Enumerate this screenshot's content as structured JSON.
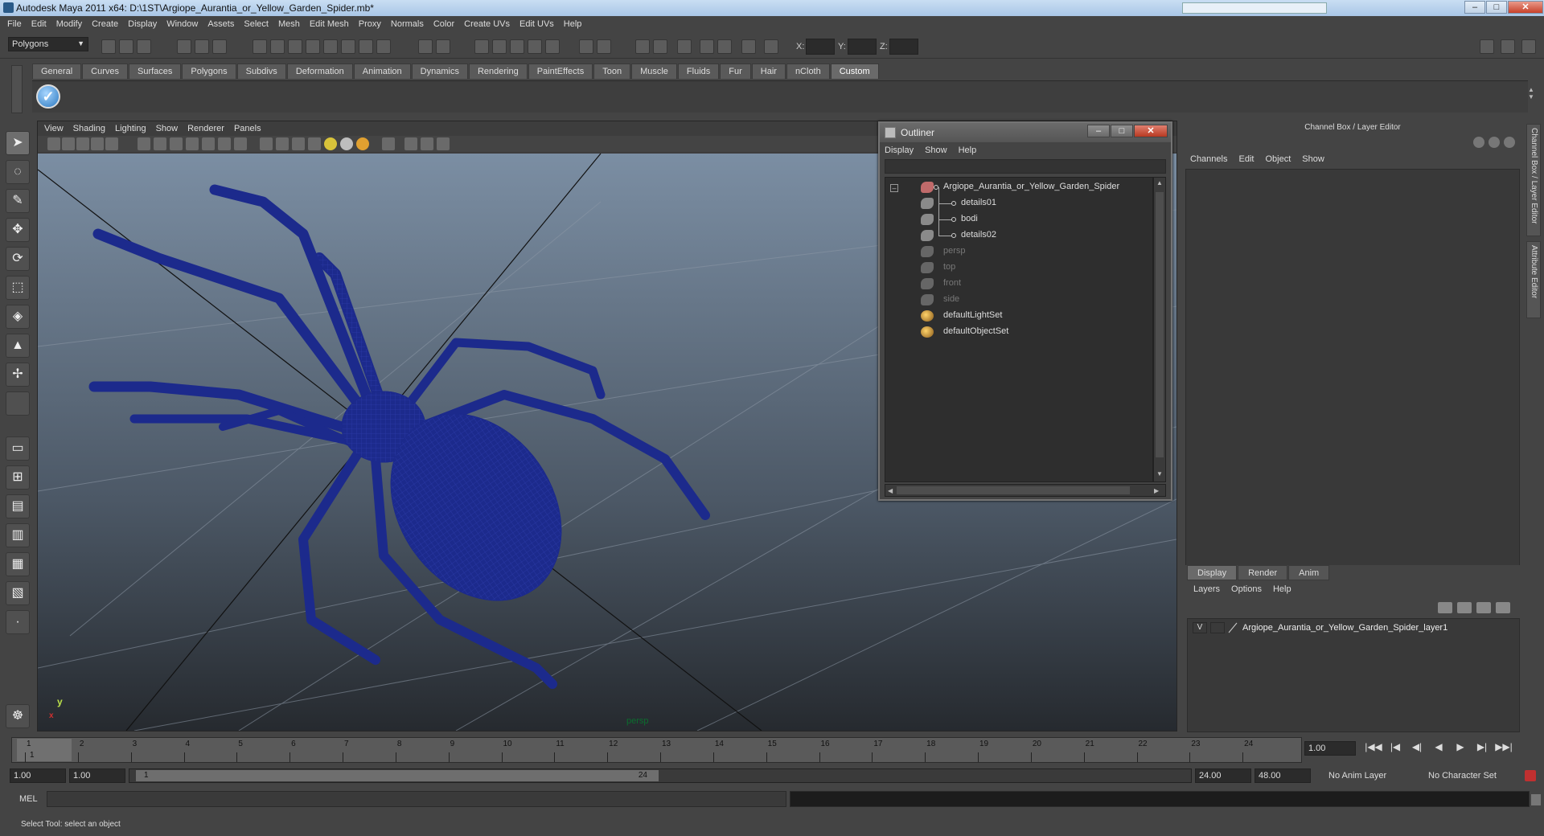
{
  "window": {
    "title": "Autodesk Maya 2011 x64: D:\\1ST\\Argiope_Aurantia_or_Yellow_Garden_Spider.mb*",
    "minimize": "–",
    "maximize": "□",
    "close": "✕"
  },
  "menubar": [
    "File",
    "Edit",
    "Modify",
    "Create",
    "Display",
    "Window",
    "Assets",
    "Select",
    "Mesh",
    "Edit Mesh",
    "Proxy",
    "Normals",
    "Color",
    "Create UVs",
    "Edit UVs",
    "Help"
  ],
  "statusline": {
    "mode": "Polygons",
    "x_label": "X:",
    "y_label": "Y:",
    "z_label": "Z:"
  },
  "shelf": {
    "tabs": [
      "General",
      "Curves",
      "Surfaces",
      "Polygons",
      "Subdivs",
      "Deformation",
      "Animation",
      "Dynamics",
      "Rendering",
      "PaintEffects",
      "Toon",
      "Muscle",
      "Fluids",
      "Fur",
      "Hair",
      "nCloth",
      "Custom"
    ],
    "active_tab": "Custom",
    "check_glyph": "✓"
  },
  "viewport": {
    "menu": [
      "View",
      "Shading",
      "Lighting",
      "Show",
      "Renderer",
      "Panels"
    ],
    "camera_label": "persp",
    "axis_y": "y",
    "axis_x": "x",
    "mesh_color": "#1c2a8c"
  },
  "outliner": {
    "title": "Outliner",
    "menu": [
      "Display",
      "Show",
      "Help"
    ],
    "expander": "–",
    "items": [
      {
        "label": "Argiope_Aurantia_or_Yellow_Garden_Spider"
      },
      {
        "label": "details01"
      },
      {
        "label": "bodi"
      },
      {
        "label": "details02"
      },
      {
        "label": "persp"
      },
      {
        "label": "top"
      },
      {
        "label": "front"
      },
      {
        "label": "side"
      },
      {
        "label": "defaultLightSet"
      },
      {
        "label": "defaultObjectSet"
      }
    ]
  },
  "channelbox": {
    "title": "Channel Box / Layer Editor",
    "menu": [
      "Channels",
      "Edit",
      "Object",
      "Show"
    ],
    "side_tabs": [
      "Channel Box / Layer Editor",
      "Attribute Editor"
    ]
  },
  "layer_editor": {
    "tabs": [
      "Display",
      "Render",
      "Anim"
    ],
    "active_tab": "Display",
    "menu": [
      "Layers",
      "Options",
      "Help"
    ],
    "layers": [
      {
        "visible": "V",
        "name": "Argiope_Aurantia_or_Yellow_Garden_Spider_layer1"
      }
    ]
  },
  "timeline": {
    "ticks": [
      "1",
      "2",
      "3",
      "4",
      "5",
      "6",
      "7",
      "8",
      "9",
      "10",
      "11",
      "12",
      "13",
      "14",
      "15",
      "16",
      "17",
      "18",
      "19",
      "20",
      "21",
      "22",
      "23",
      "24"
    ],
    "current_frame_marker": "1",
    "current_frame": "1.00",
    "playback": [
      "|◀◀",
      "|◀",
      "◀|",
      "◀",
      "▶",
      "▶|",
      "▶▶|"
    ]
  },
  "range": {
    "start": "1.00",
    "playback_start": "1.00",
    "thumb_start": "1",
    "thumb_end": "24",
    "playback_end": "24.00",
    "end": "48.00",
    "anim_layer": "No Anim Layer",
    "character_set": "No Character Set"
  },
  "command_line": {
    "label": "MEL"
  },
  "help_line": "Select Tool: select an object"
}
